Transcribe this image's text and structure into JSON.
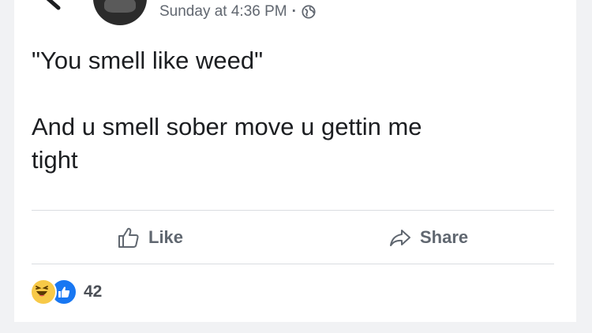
{
  "post": {
    "timestamp": "Sunday at 4:36 PM",
    "separator": "·",
    "privacy_icon": "globe-icon",
    "text": "\"You smell like weed\"\n\nAnd u smell sober move u gettin me\ntight"
  },
  "actions": {
    "like_label": "Like",
    "share_label": "Share"
  },
  "reactions": {
    "icons": [
      "haha-icon",
      "like-reaction-icon"
    ],
    "count": "42"
  },
  "colors": {
    "page_background": "#f1f2f4",
    "card_background": "#ffffff",
    "text_primary": "#1c1e21",
    "text_secondary": "#606770",
    "divider": "#dadde1",
    "like_blue": "#1877f2",
    "haha_yellow": "#f7c948"
  }
}
